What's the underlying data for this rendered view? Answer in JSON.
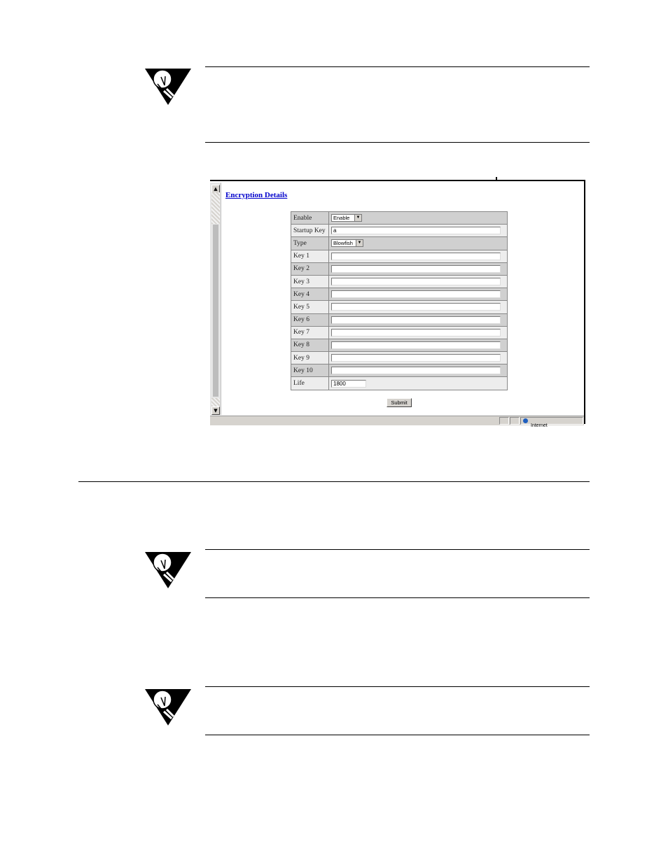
{
  "notes": [
    {
      "icon": "lightbulb-note-icon"
    },
    {
      "icon": "lightbulb-note-icon"
    },
    {
      "icon": "lightbulb-note-icon"
    }
  ],
  "screenshot": {
    "page_title": "Encryption Details",
    "scroll_up": "▲",
    "scroll_down": "▼",
    "fields": [
      {
        "label": "Enable",
        "kind": "select",
        "value": "Enable"
      },
      {
        "label": "Startup Key",
        "kind": "text",
        "value": "a"
      },
      {
        "label": "Type",
        "kind": "select",
        "value": "Blowfish"
      },
      {
        "label": "Key 1",
        "kind": "text",
        "value": ""
      },
      {
        "label": "Key 2",
        "kind": "text",
        "value": ""
      },
      {
        "label": "Key 3",
        "kind": "text",
        "value": ""
      },
      {
        "label": "Key 4",
        "kind": "text",
        "value": ""
      },
      {
        "label": "Key 5",
        "kind": "text",
        "value": ""
      },
      {
        "label": "Key 6",
        "kind": "text",
        "value": ""
      },
      {
        "label": "Key 7",
        "kind": "text",
        "value": ""
      },
      {
        "label": "Key 8",
        "kind": "text",
        "value": ""
      },
      {
        "label": "Key 9",
        "kind": "text",
        "value": ""
      },
      {
        "label": "Key 10",
        "kind": "text",
        "value": ""
      },
      {
        "label": "Life",
        "kind": "short",
        "value": "1800"
      }
    ],
    "submit_label": "Submit",
    "status_zone": "Internet"
  }
}
